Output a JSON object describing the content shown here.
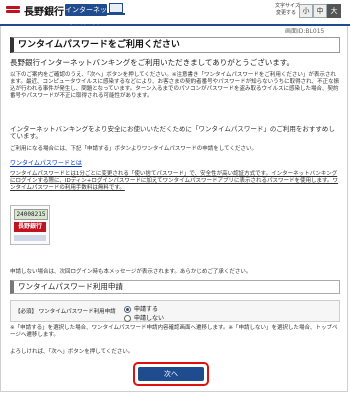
{
  "header": {
    "bank_name": "長野銀行",
    "service_badge": "インターネットバンキング",
    "font_size_label": "文字サイズ\n変更する",
    "size_small": "小",
    "size_medium": "中",
    "size_large": "大"
  },
  "screen_id": "画面ID:BL015",
  "page_title": "ワンタイムパスワードをご利用ください",
  "welcome": "長野銀行インターネットバンキングをご利用いただきましてありがとうございます。",
  "paragraphs": {
    "p1": "以下のご案内をご確認のうえ、「次へ」ボタンを押してください。※注意書き「ワンタイムパスワードをご利用ください」が表示されます。最近、コンピュータウイルスに感染するなどにより、お客さまの契約者番号やパスワードが知らないうちに取得され、不正な振込が行われる事件が発生し、問題となっています。ターン入るまでのパソコンがパスワードを盗み取るウイルスに感染した場合、契約番号やパスワードが不正に取得される可能性があります。",
    "p2": "インターネットバンキングをより安全にお使いいただくために「ワンタイムパスワード」のご利用をおすすめしています。",
    "p3": "ご利用になる場合には、下記「申請する」ボタンよりワンタイムパスワードの申請をしてください。"
  },
  "link_text": "ワンタイムパスワードとは",
  "explanation": "ワンタイムパスワードとは1分ごとに変更される「使い捨てパスワード」で、安全性が高い認証方式です。インターネットバンキングにログインする際に、IDディン+ログインパスワードに加えてワンタイムパスワードアプリに表示されるパスワードを使用します。ワンタイムパスワードの利用手数料は無料です。",
  "token": {
    "number": "24008215",
    "logo": "長野銀行"
  },
  "note_skip": "申請しない場合は、次回ログイン時も本メッセージが表示されます。あらかじめご了承ください。",
  "section_title": "ワンタイムパスワード利用申請",
  "form": {
    "label": "【必須】 ワンタイムパスワード利用申請",
    "option_apply": "申請する",
    "option_no": "申請しない"
  },
  "notes_after": "※「申請する」を選択した場合、ワンタイムパスワード申請内容確認画面へ遷移します。※「申請しない」を選択した場合、トップページへ遷移します。",
  "confirm_text": "よろしければ、「次へ」ボタンを押してください。",
  "next_button": "次へ"
}
